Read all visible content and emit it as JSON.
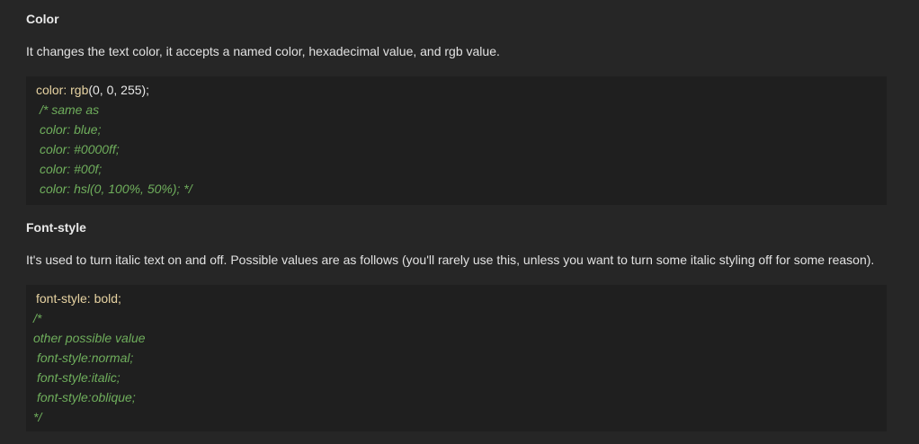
{
  "sections": [
    {
      "heading": "Color",
      "description": "It changes the text color, it accepts a named color, hexadecimal value, and rgb value.",
      "code": {
        "decl_prop": "color: rgb",
        "decl_args": "(0, 0, 255);",
        "comment_lines": [
          "/* same as",
          "color: blue;",
          "color: #0000ff;",
          "color: #00f;",
          "color: hsl(0, 100%, 50%); */"
        ]
      }
    },
    {
      "heading": "Font-style",
      "description": "It's used to turn italic text on and off. Possible values are as follows (you'll rarely use this, unless you want to turn some italic styling off for some reason).",
      "code": {
        "decl": "font-style: bold;",
        "comment_lines": [
          "/*",
          "other possible value",
          "font-style:normal;",
          "font-style:italic;",
          "font-style:oblique;",
          "*/"
        ]
      }
    }
  ]
}
